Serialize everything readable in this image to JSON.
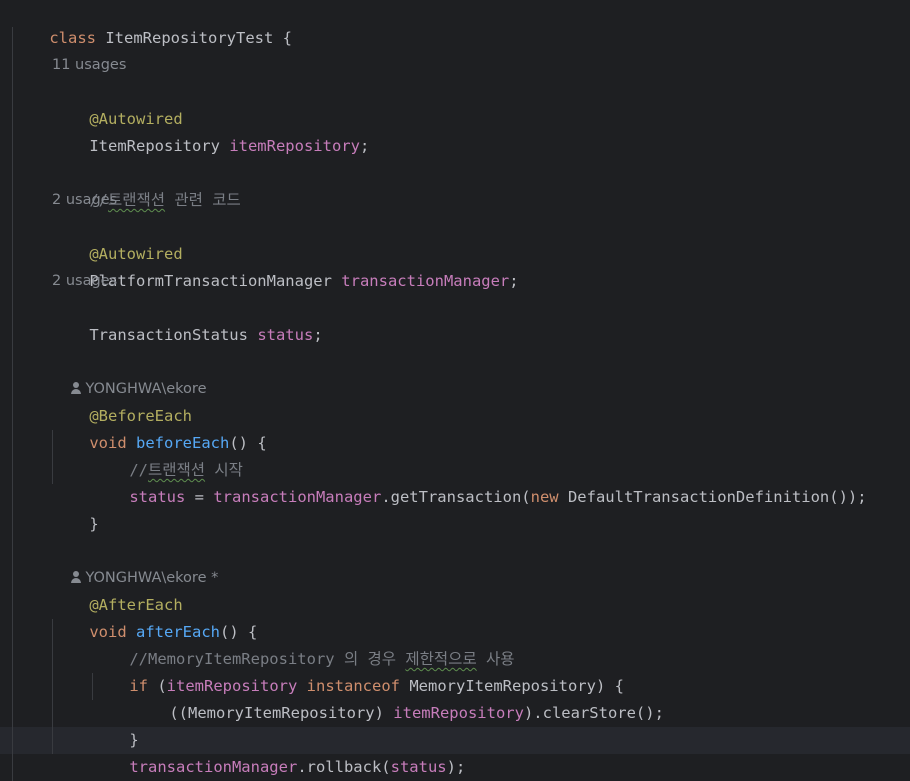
{
  "header": {
    "class_keyword": "class",
    "class_name": "ItemRepositoryTest",
    "open_brace": " {"
  },
  "field_item": {
    "usage_hint": "11 usages",
    "annotation": "@Autowired",
    "type": "ItemRepository ",
    "name": "itemRepository",
    "semicolon": ";"
  },
  "comment_tx": {
    "prefix": "//",
    "typo": "트랜잭션",
    "rest": " 관련 코드"
  },
  "field_tm": {
    "usage_hint": "2 usages",
    "annotation": "@Autowired",
    "type": "PlatformTransactionManager ",
    "name": "transactionManager",
    "semicolon": ";"
  },
  "field_status": {
    "usage_hint": "2 usages",
    "type": "TransactionStatus ",
    "name": "status",
    "semicolon": ";"
  },
  "before_each": {
    "author_hint": "YONGHWA\\ekore",
    "annotation": "@BeforeEach",
    "void_kw": "void ",
    "method_name": "beforeEach",
    "sig_rest": "() {",
    "comment_prefix": "//",
    "comment_typo": "트랜잭션",
    "comment_rest": " 시작",
    "stmt_var": "status",
    "stmt_eq": " = ",
    "stmt_field": "transactionManager",
    "stmt_call": ".getTransaction(",
    "stmt_new": "new",
    "stmt_tail": " DefaultTransactionDefinition());",
    "close_brace": "}"
  },
  "after_each": {
    "author_hint": "YONGHWA\\ekore *",
    "annotation": "@AfterEach",
    "void_kw": "void ",
    "method_name": "afterEach",
    "sig_rest": "() {",
    "comment_before": "//MemoryItemRepository 의 경우 ",
    "comment_typo": "제한적으로",
    "comment_after": " 사용",
    "if_kw": "if",
    "if_open": " (",
    "if_field": "itemRepository",
    "if_space": " ",
    "instanceof_kw": "instanceof",
    "if_tail": " MemoryItemRepository) {",
    "cast_open": "((MemoryItemRepository) ",
    "cast_field": "itemRepository",
    "cast_tail": ").clearStore();",
    "inner_close": "}",
    "rollback_field": "transactionManager",
    "rollback_call": ".rollback(",
    "rollback_arg": "status",
    "rollback_tail": ");",
    "close_brace": "}"
  }
}
